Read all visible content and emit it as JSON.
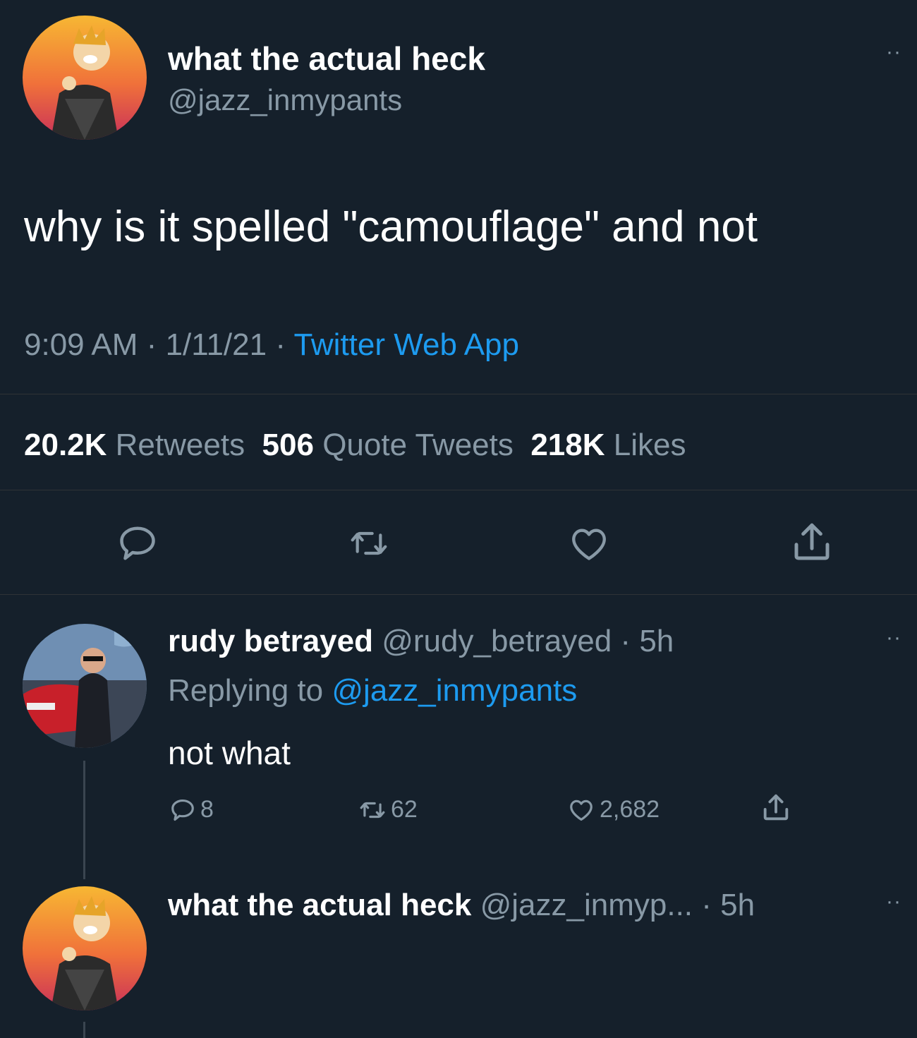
{
  "main_tweet": {
    "display_name": "what the actual heck",
    "handle": "@jazz_inmypants",
    "more": "··",
    "text": "why is it spelled \"camouflage\" and not",
    "time": "9:09 AM",
    "sep1": "·",
    "date": "1/11/21",
    "sep2": "·",
    "source": "Twitter Web App",
    "stats": {
      "retweets_count": "20.2K",
      "retweets_label": "Retweets",
      "quotes_count": "506",
      "quotes_label": "Quote Tweets",
      "likes_count": "218K",
      "likes_label": "Likes"
    }
  },
  "reply": {
    "display_name": "rudy betrayed",
    "handle": "@rudy_betrayed",
    "sep": "·",
    "time": "5h",
    "more": "··",
    "replying_prefix": "Replying to",
    "replying_handle": "@jazz_inmypants",
    "text": "not what",
    "reply_count": "8",
    "retweet_count": "62",
    "like_count": "2,682"
  },
  "next_tweet": {
    "display_name": "what the actual heck",
    "handle": "@jazz_inmyp...",
    "sep": "·",
    "time": "5h",
    "more": "··"
  },
  "icons": {
    "reply": "reply-icon",
    "retweet": "retweet-icon",
    "like": "heart-icon",
    "share": "share-icon"
  },
  "colors": {
    "background": "#15202b",
    "link": "#1d9bf0",
    "muted": "#8899a6"
  }
}
